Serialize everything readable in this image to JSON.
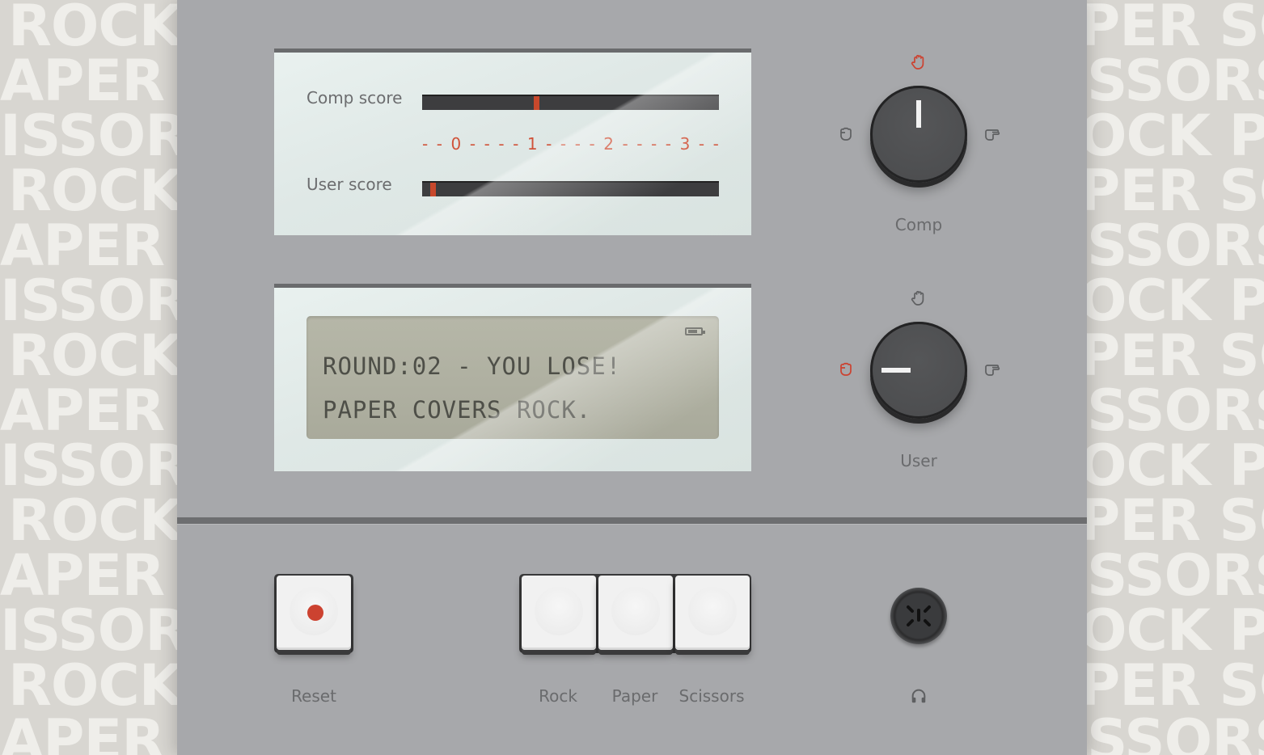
{
  "background_pattern": {
    "words_left": [
      "ROCK",
      "APER",
      "ISSOR",
      "ROCK",
      "APER",
      "ISSOR",
      "ROCK",
      "APER",
      "ISSOR",
      "ROCK",
      "APER",
      "ISSOR",
      "ROCK",
      "APER"
    ],
    "words_right": [
      "PER SC",
      "SSORS",
      "OCK PA",
      "PER SC",
      "SSORS",
      "OCK PA",
      "PER SC",
      "SSORS",
      "OCK PA",
      "PER SC",
      "SSORS",
      "OCK PA",
      "PER SC",
      "SSORS"
    ]
  },
  "scoreboard": {
    "comp_label": "Comp score",
    "user_label": "User score",
    "scale_ticks": [
      "-",
      "-",
      "0",
      "-",
      "-",
      "-",
      "-",
      "1",
      "-",
      "-",
      "-",
      "-",
      "2",
      "-",
      "-",
      "-",
      "-",
      "3",
      "-",
      "-"
    ],
    "comp_score": 1.35,
    "user_score": 0.1,
    "scale_max": 3.6
  },
  "display": {
    "line1": "ROUND:02 - YOU LOSE!",
    "line2": "PAPER COVERS ROCK.",
    "battery_icon": "battery-icon"
  },
  "knobs": {
    "comp": {
      "label": "Comp",
      "selected": "paper"
    },
    "user": {
      "label": "User",
      "selected": "rock"
    }
  },
  "controls": {
    "reset_label": "Reset",
    "rock_label": "Rock",
    "paper_label": "Paper",
    "scissors_label": "Scissors",
    "headphones_icon": "headphones-icon"
  },
  "colors": {
    "accent": "#cc4230",
    "body": "#a7a8ab",
    "lcd": "#b0b1a2",
    "icon_idle": "#5e5f61"
  }
}
